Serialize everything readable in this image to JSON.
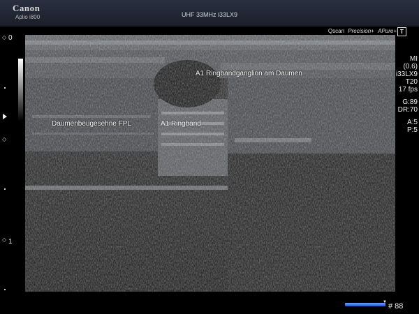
{
  "header": {
    "brand": "Canon",
    "model": "Aplio i800",
    "probe_info": "UHF 33MHz i33LX9"
  },
  "modes": {
    "qscan": "Qscan",
    "precision": "Precision+",
    "apure": "APure+",
    "t_box": "T"
  },
  "depth_scale": {
    "top_label": "0",
    "mid_label": "1"
  },
  "parameters": {
    "mi_label": "MI",
    "mi_value": "(0.6)",
    "probe": "i33LX9",
    "preset": "T20",
    "fps": "17 fps",
    "gain": "G:89",
    "dynamic_range": "DR:70",
    "a": "A:5",
    "p": "P:5"
  },
  "annotations": {
    "ganglion": "A1 Ringbandganglion am Daumen",
    "tendon": "Daumenbeugesehne FPL",
    "pulley": "A1 Ringband"
  },
  "frame": {
    "label": "# 88"
  },
  "cine": {
    "progress": 0.98
  },
  "colors": {
    "cine_bar": "#2f6be0",
    "background": "#000000"
  }
}
